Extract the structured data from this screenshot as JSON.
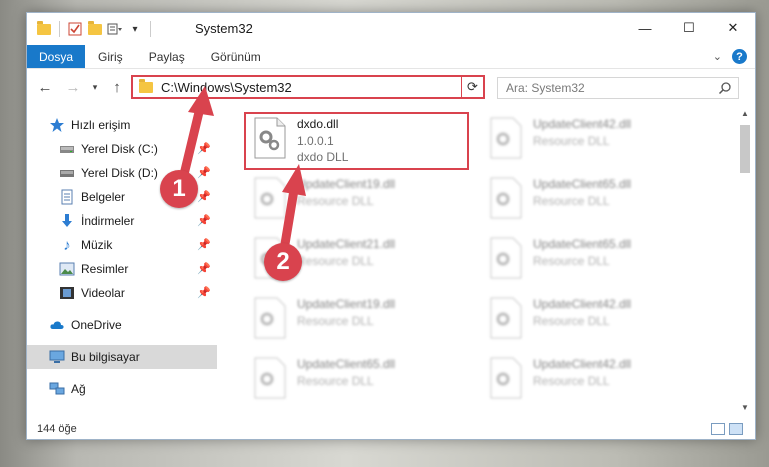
{
  "window": {
    "title": "System32",
    "controls": {
      "minimize": "—",
      "maximize": "☐",
      "close": "✕"
    }
  },
  "ribbon": {
    "tabs": [
      "Dosya",
      "Giriş",
      "Paylaş",
      "Görünüm"
    ],
    "active_tab": "Dosya",
    "help": "?"
  },
  "address": {
    "path": "C:\\Windows\\System32",
    "refresh_icon": "⟳"
  },
  "search": {
    "placeholder": "Ara: System32"
  },
  "nav": {
    "items": [
      {
        "label": "Hızlı erişim",
        "icon": "star-icon"
      },
      {
        "label": "Yerel Disk (C:)",
        "icon": "drive-icon",
        "pinned": true
      },
      {
        "label": "Yerel Disk (D:)",
        "icon": "drive-icon",
        "pinned": true
      },
      {
        "label": "Belgeler",
        "icon": "document-icon",
        "pinned": true
      },
      {
        "label": "İndirmeler",
        "icon": "download-icon",
        "pinned": true
      },
      {
        "label": "Müzik",
        "icon": "music-icon",
        "pinned": true
      },
      {
        "label": "Resimler",
        "icon": "picture-icon",
        "pinned": true
      },
      {
        "label": "Videolar",
        "icon": "video-icon",
        "pinned": true
      },
      {
        "label": "OneDrive",
        "icon": "cloud-icon"
      },
      {
        "label": "Bu bilgisayar",
        "icon": "computer-icon",
        "selected": true
      },
      {
        "label": "Ağ",
        "icon": "network-icon"
      }
    ]
  },
  "files": [
    {
      "name": "dxdo.dll",
      "version": "1.0.0.1",
      "desc": "dxdo DLL"
    },
    {
      "name": "UpdateClient42.dll",
      "desc": "Resource DLL"
    },
    {
      "name": "UpdateClient19.dll",
      "desc": "Resource DLL"
    },
    {
      "name": "UpdateClient65.dll",
      "desc": "Resource DLL"
    },
    {
      "name": "UpdateClient21.dll",
      "desc": "Resource DLL"
    },
    {
      "name": "UpdateClient65.dll",
      "desc": "Resource DLL"
    },
    {
      "name": "UpdateClient19.dll",
      "desc": "Resource DLL"
    },
    {
      "name": "UpdateClient42.dll",
      "desc": "Resource DLL"
    },
    {
      "name": "UpdateClient65.dll",
      "desc": "Resource DLL"
    },
    {
      "name": "UpdateClient42.dll",
      "desc": "Resource DLL"
    }
  ],
  "status": {
    "count": "144 öğe"
  },
  "annotations": {
    "step1": "1",
    "step2": "2"
  },
  "colors": {
    "accent": "#1979ca",
    "annotation": "#d9434e",
    "folder": "#f5c542"
  }
}
